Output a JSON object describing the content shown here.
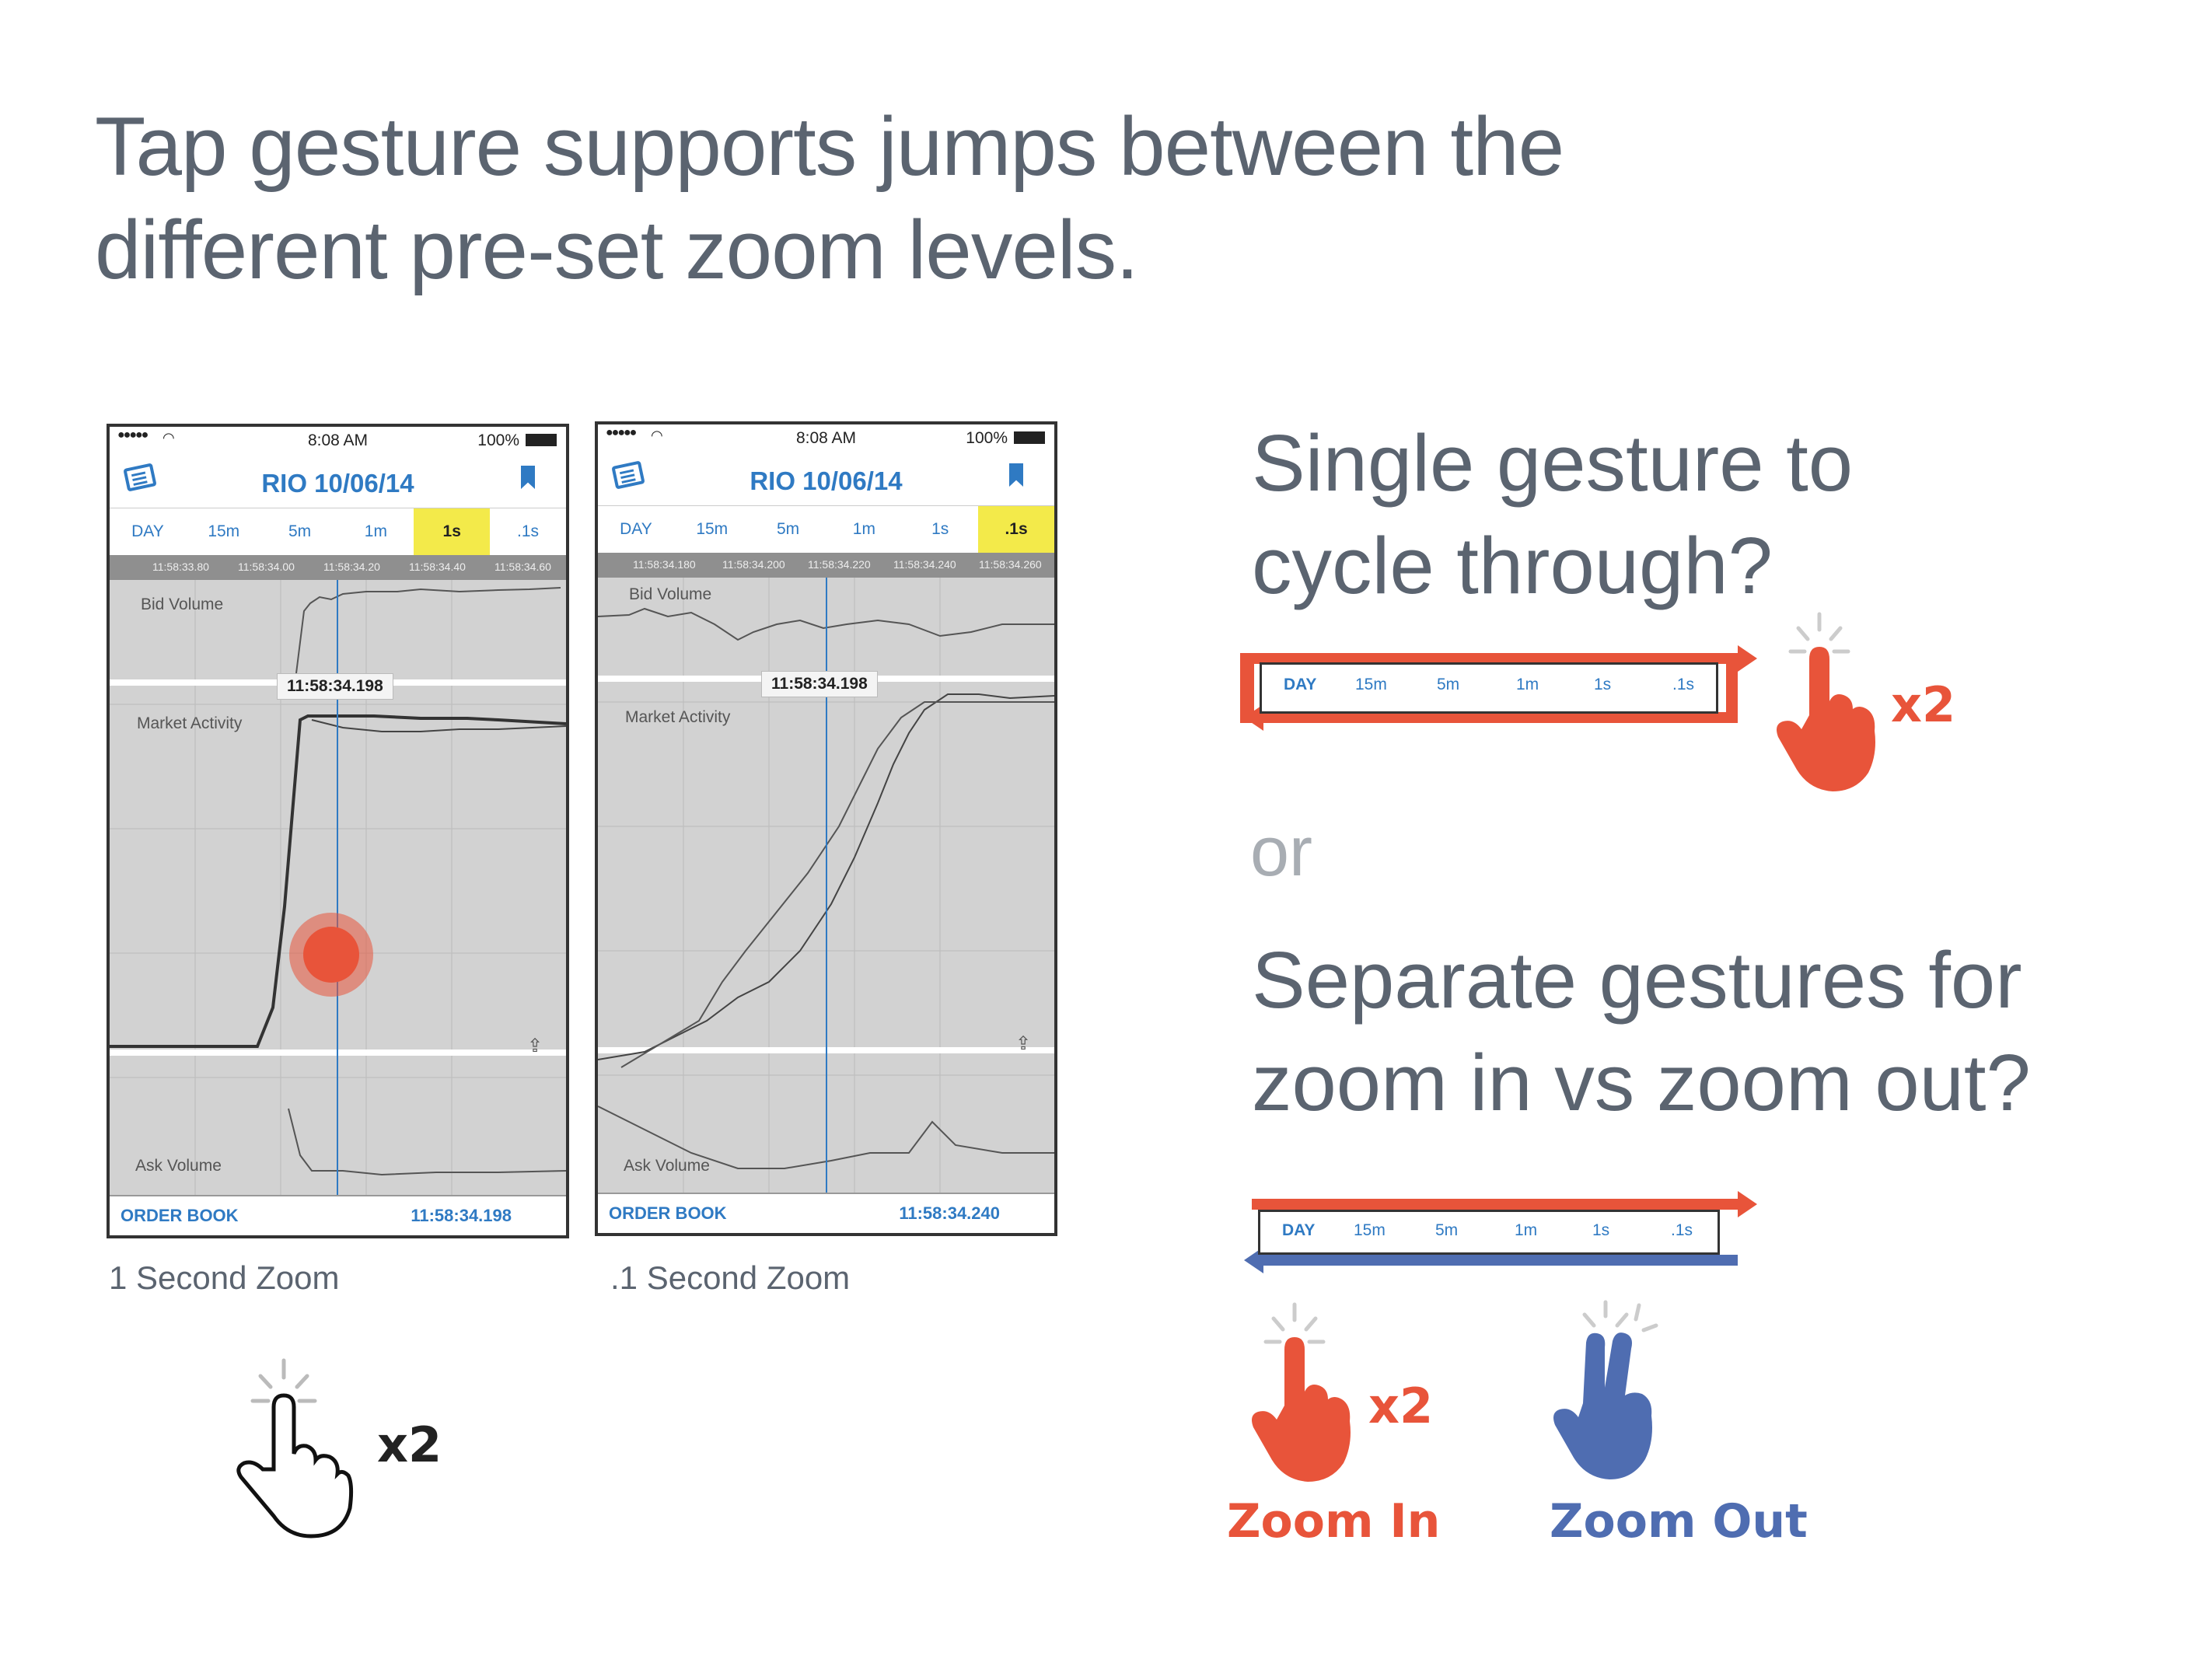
{
  "title": {
    "line1": "Tap gesture supports jumps between the",
    "line2": "different pre-set zoom levels."
  },
  "phones": [
    {
      "status_time": "8:08 AM",
      "battery": "100%",
      "header_title": "RIO   10/06/14",
      "tabs": [
        "DAY",
        "15m",
        "5m",
        "1m",
        "1s",
        ".1s"
      ],
      "selected_tab": "1s",
      "time_ticks": [
        "11:58:33.80",
        "11:58:34.00",
        "11:58:34.20",
        "11:58:34.40",
        "11:58:34.60"
      ],
      "cursor_label": "11:58:34.198",
      "bid_label": "Bid Volume",
      "market_label": "Market Activity",
      "ask_label": "Ask Volume",
      "footer_left": "ORDER BOOK",
      "footer_time": "11:58:34.198",
      "caption": "1 Second Zoom"
    },
    {
      "status_time": "8:08 AM",
      "battery": "100%",
      "header_title": "RIO   10/06/14",
      "tabs": [
        "DAY",
        "15m",
        "5m",
        "1m",
        "1s",
        ".1s"
      ],
      "selected_tab": ".1s",
      "time_ticks": [
        "11:58:34.180",
        "11:58:34.200",
        "11:58:34.220",
        "11:58:34.240",
        "11:58:34.260"
      ],
      "cursor_label": "11:58:34.198",
      "bid_label": "Bid Volume",
      "market_label": "Market Activity",
      "ask_label": "Ask Volume",
      "footer_left": "ORDER BOOK",
      "footer_time": "11:58:34.240",
      "caption": ".1 Second Zoom"
    }
  ],
  "tap_multiplier": "x2",
  "questions": {
    "q1_line1": "Single gesture to",
    "q1_line2": "cycle through?",
    "or": "or",
    "q2_line1": "Separate gestures for",
    "q2_line2": "zoom in vs zoom out?"
  },
  "zoom_levels": [
    "DAY",
    "15m",
    "5m",
    "1m",
    "1s",
    ".1s"
  ],
  "zoom_in_label": "Zoom In",
  "zoom_out_label": "Zoom Out",
  "colors": {
    "accent_red": "#e8543a",
    "accent_blue": "#4f6db1",
    "ui_blue": "#2f7ac3",
    "highlight_yellow": "#f3ea4a"
  }
}
